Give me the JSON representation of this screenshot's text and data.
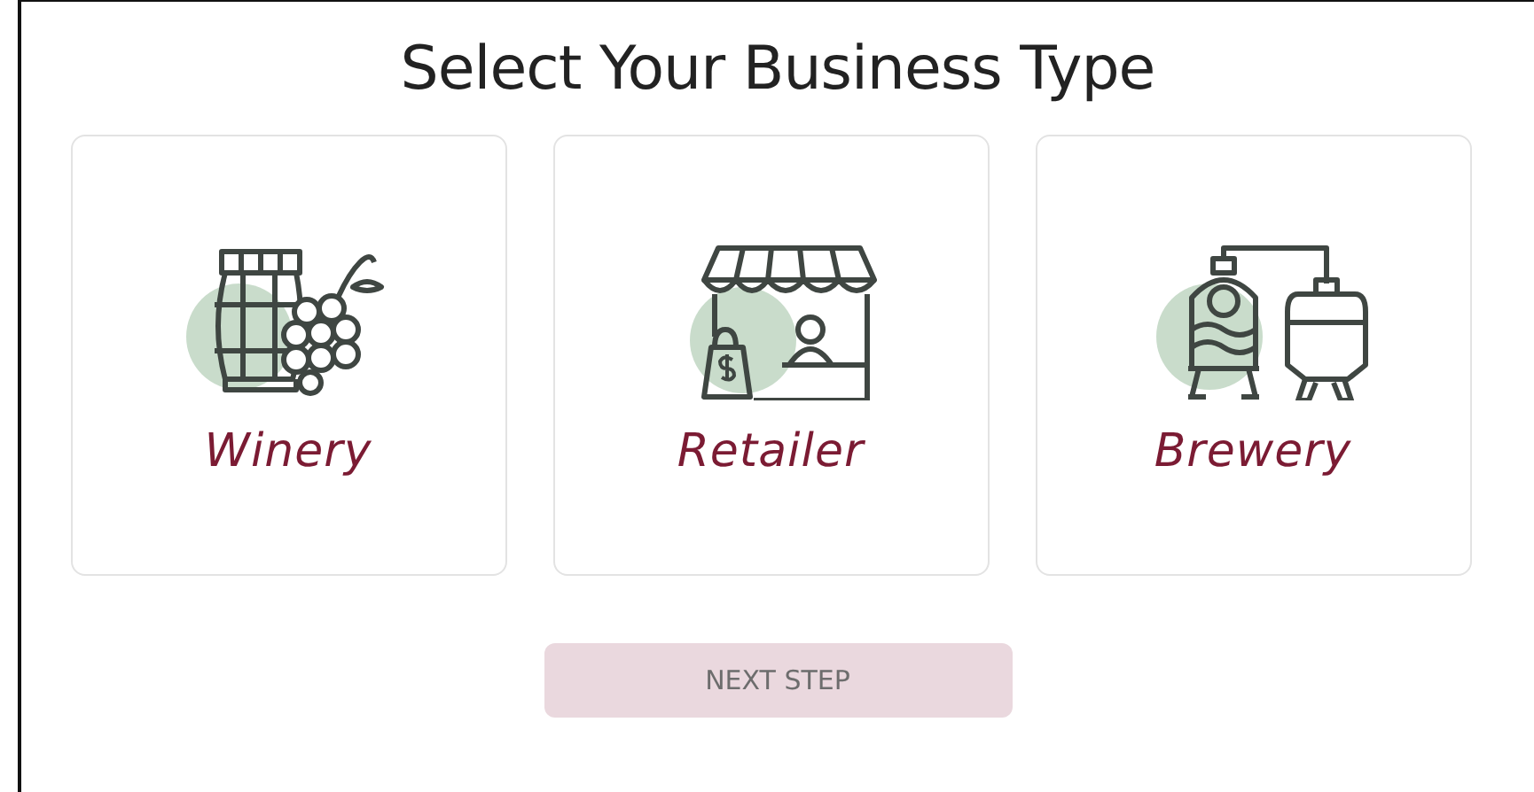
{
  "title": "Select Your Business Type",
  "options": [
    {
      "label": "Winery",
      "selected": false
    },
    {
      "label": "Retailer",
      "selected": false
    },
    {
      "label": "Brewery",
      "selected": false
    }
  ],
  "button": {
    "label": "NEXT STEP",
    "disabled": true
  }
}
